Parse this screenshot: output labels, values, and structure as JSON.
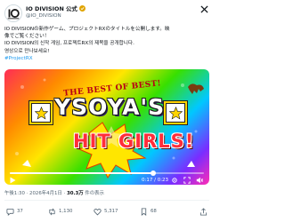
{
  "tweet": {
    "display_name": "IO DIVISION 公式",
    "handle": "@IO_DIVISION",
    "text_lines": [
      "IO DIVISIONの新作ゲーム、プロジェクトRXのタイトルを公開します。映",
      "像でご覧ください！",
      "IO DIVISION의 신작 게임, 프로젝트RX의 제목을 공개합니다.",
      "영상으로 만나보세요!"
    ],
    "hashtag": "#ProjectRX",
    "timestamp": "午後1:30 · 2026年4月1日 ·",
    "views_count": "30.3万",
    "views_label": " 件の表示"
  },
  "video": {
    "title_top": "THE BEST OF BEST!",
    "title_main": "YSOYA'S",
    "title_sub": "HIT GIRLS!",
    "time_label": "0:17 / 0:23",
    "progress": 0.74
  },
  "actions": {
    "reply_count": "37",
    "retweet_count": "1,130",
    "like_count": "5,317",
    "bookmark_count": "68"
  },
  "icons": [
    "avatar-logo",
    "verified-badge-icon",
    "x-logo-icon",
    "play-icon",
    "volume-icon",
    "settings-icon",
    "fullscreen-icon",
    "reply-icon",
    "retweet-icon",
    "like-icon",
    "bookmark-icon",
    "share-icon",
    "star-icon"
  ],
  "colors": {
    "accent": "#1d9bf0",
    "verified": "#e0a400",
    "text": "#0f1419",
    "muted": "#536471"
  }
}
